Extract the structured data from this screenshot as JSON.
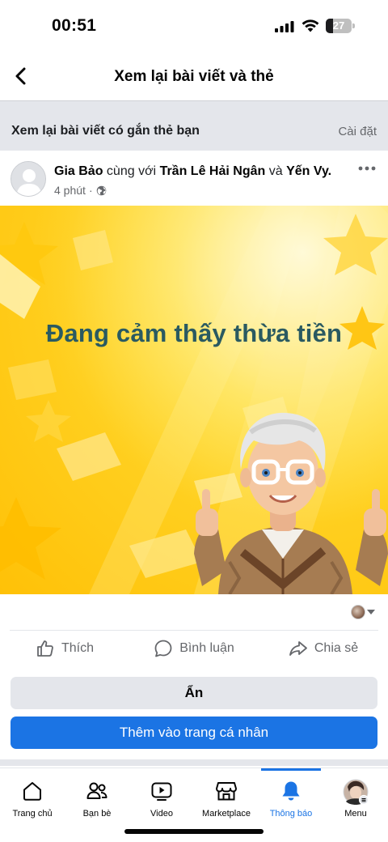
{
  "status_bar": {
    "time": "00:51",
    "battery": "27"
  },
  "header": {
    "title": "Xem lại bài viết và thẻ"
  },
  "section": {
    "title": "Xem lại bài viết có gắn thẻ bạn",
    "action": "Cài đặt"
  },
  "post": {
    "author": "Gia Bảo",
    "with_text": "cùng với",
    "tagged_1": "Trần Lê Hải Ngân",
    "and_text": "và",
    "tagged_2": "Yến Vy.",
    "time": "4 phút",
    "separator": "·",
    "image_text": "Đang cảm thấy thừa tiền"
  },
  "actions": {
    "like": "Thích",
    "comment": "Bình luận",
    "share": "Chia sẻ"
  },
  "buttons": {
    "hide": "Ẩn",
    "add": "Thêm vào trang cá nhân"
  },
  "tabs": [
    {
      "label": "Trang chủ",
      "icon": "home-icon"
    },
    {
      "label": "Bạn bè",
      "icon": "friends-icon"
    },
    {
      "label": "Video",
      "icon": "video-icon"
    },
    {
      "label": "Marketplace",
      "icon": "marketplace-icon"
    },
    {
      "label": "Thông báo",
      "icon": "bell-icon",
      "active": true
    },
    {
      "label": "Menu",
      "icon": "profile-avatar-icon"
    }
  ],
  "colors": {
    "accent": "#1b74e4",
    "image_yellow": "#ffc107",
    "image_text": "#2a5a61"
  }
}
